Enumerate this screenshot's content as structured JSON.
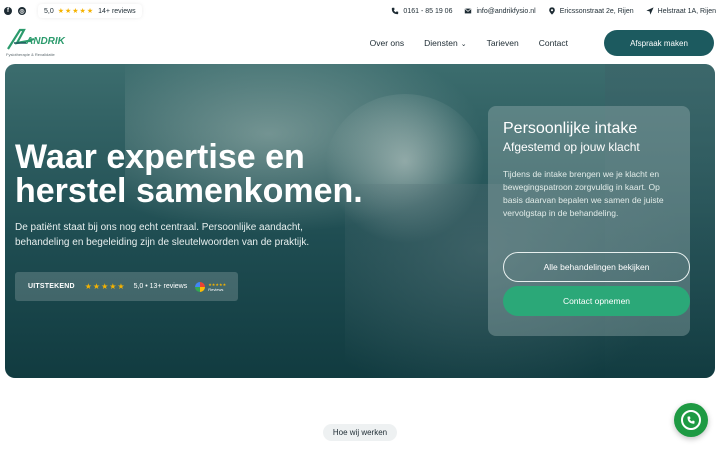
{
  "topbar": {
    "rating_score": "5,0",
    "rating_stars": "★★★★★",
    "rating_count": "14+ reviews",
    "phone": "0161 - 85 19 06",
    "email": "info@andrikfysio.nl",
    "address1": "Ericssonstraat 2e, Rijen",
    "address2": "Helstraat 1A, Rijen"
  },
  "header": {
    "logo_text": "ANDRIK",
    "logo_subtitle": "Fysiotherapie & Revalidatie",
    "nav": [
      "Over ons",
      "Diensten",
      "Tarieven",
      "Contact"
    ],
    "cta": "Afspraak maken"
  },
  "hero": {
    "title": "Waar expertise en herstel samenkomen.",
    "text": "De patiënt staat bij ons nog echt centraal. Persoonlijke aandacht, behandeling en begeleiding zijn de sleutelwoorden van de praktijk.",
    "badge": {
      "label": "UITSTEKEND",
      "stars": "★★★★★",
      "score": "5,0 • 13+ reviews",
      "google_label": "Reviews"
    }
  },
  "card": {
    "title": "Persoonlijke intake",
    "subtitle": "Afgestemd op jouw klacht",
    "text": "Tijdens de intake brengen we je klacht en bewegingspatroon zorgvuldig in kaart. Op basis daarvan bepalen we samen de juiste vervolgstap in de behandeling.",
    "btn_treatments": "Alle behandelingen bekijken",
    "btn_contact": "Contact opnemen"
  },
  "below": {
    "how_label": "Hoe wij werken"
  },
  "colors": {
    "primary": "#1c5a5f",
    "accent_green": "#2ba878",
    "star": "#f5b301",
    "whatsapp": "#1e9a43"
  }
}
